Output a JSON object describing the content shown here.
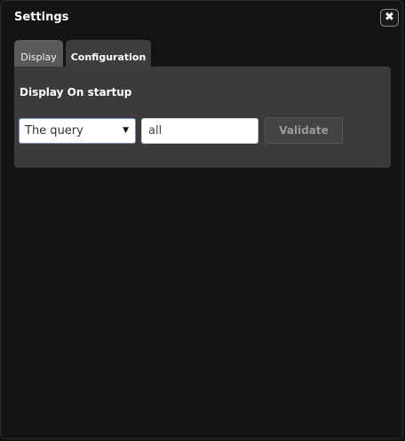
{
  "dialog": {
    "title": "Settings",
    "close_icon": "close-icon"
  },
  "tabs": [
    {
      "label": "Display",
      "active": true
    },
    {
      "label": "Configuration",
      "active": false
    }
  ],
  "panel": {
    "section_label": "Display On startup",
    "select": {
      "selected": "The query",
      "arrow_icon": "dropdown-arrow-icon"
    },
    "input": {
      "value": "all"
    },
    "validate_label": "Validate"
  },
  "colors": {
    "background": "#111111",
    "panel": "#3b3b3b",
    "active_tab": "#5a5a5a",
    "inactive_tab": "#3d3d3d",
    "select_border": "#6f8fcf"
  }
}
